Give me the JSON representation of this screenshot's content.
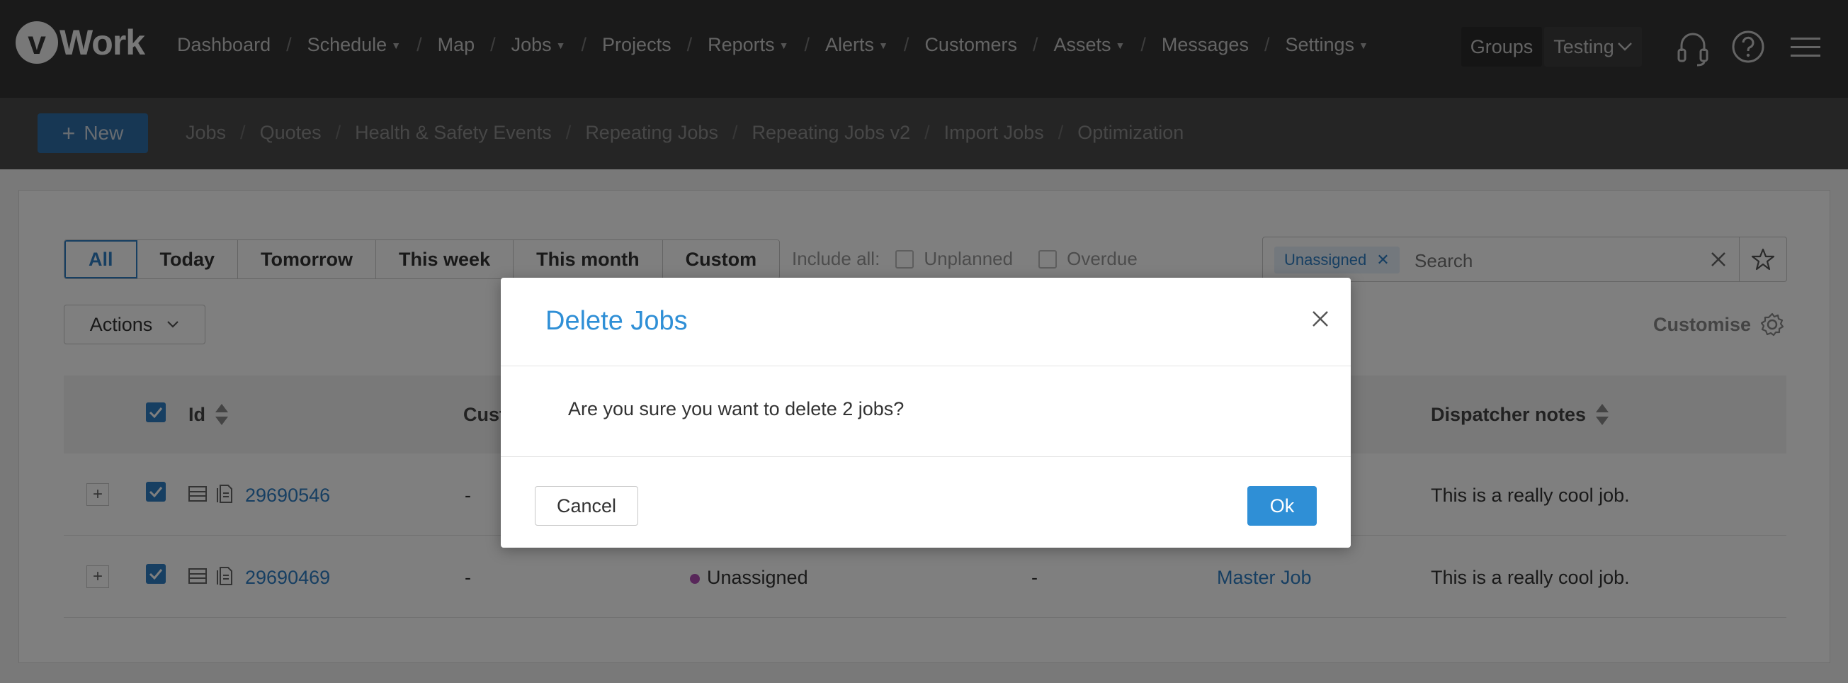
{
  "app": {
    "logo_letter": "v",
    "logo_text": "Work"
  },
  "main_nav": {
    "items": [
      {
        "label": "Dashboard",
        "has_caret": false
      },
      {
        "label": "Schedule",
        "has_caret": true
      },
      {
        "label": "Map",
        "has_caret": false
      },
      {
        "label": "Jobs",
        "has_caret": true
      },
      {
        "label": "Projects",
        "has_caret": false
      },
      {
        "label": "Reports",
        "has_caret": true
      },
      {
        "label": "Alerts",
        "has_caret": true
      },
      {
        "label": "Customers",
        "has_caret": false
      },
      {
        "label": "Assets",
        "has_caret": true
      },
      {
        "label": "Messages",
        "has_caret": false
      },
      {
        "label": "Settings",
        "has_caret": true
      }
    ],
    "groups_label": "Groups",
    "account_label": "Testing",
    "icons": [
      "headset-icon",
      "help-icon",
      "hamburger-menu-icon"
    ]
  },
  "sub_nav": {
    "new_label": "New",
    "items": [
      "Jobs",
      "Quotes",
      "Health & Safety Events",
      "Repeating Jobs",
      "Repeating Jobs v2",
      "Import Jobs",
      "Optimization"
    ]
  },
  "filters": {
    "buttons": [
      "All",
      "Today",
      "Tomorrow",
      "This week",
      "This month",
      "Custom"
    ],
    "active": "All",
    "include_label": "Include all:",
    "include_options": [
      "Unplanned",
      "Overdue"
    ]
  },
  "search": {
    "chip": "Unassigned",
    "placeholder": "Search"
  },
  "toolbar": {
    "actions_label": "Actions",
    "customise_label": "Customise"
  },
  "table": {
    "headers": {
      "id": "Id",
      "customer": "Cust",
      "dispatcher_notes": "Dispatcher notes"
    },
    "rows": [
      {
        "id": "29690546",
        "customer": "-",
        "status": "",
        "col4": "",
        "template": "",
        "notes": "This is a really cool job."
      },
      {
        "id": "29690469",
        "customer": "-",
        "status": "Unassigned",
        "col4": "-",
        "template": "Master Job",
        "notes": "This is a really cool job."
      }
    ]
  },
  "modal": {
    "title": "Delete Jobs",
    "message": "Are you sure you want to delete 2 jobs?",
    "cancel_label": "Cancel",
    "ok_label": "Ok"
  },
  "colors": {
    "accent": "#2f8fd6",
    "topnav": "#343434",
    "subnav": "#4b4b4b",
    "status_unassigned": "#b04fb5"
  }
}
